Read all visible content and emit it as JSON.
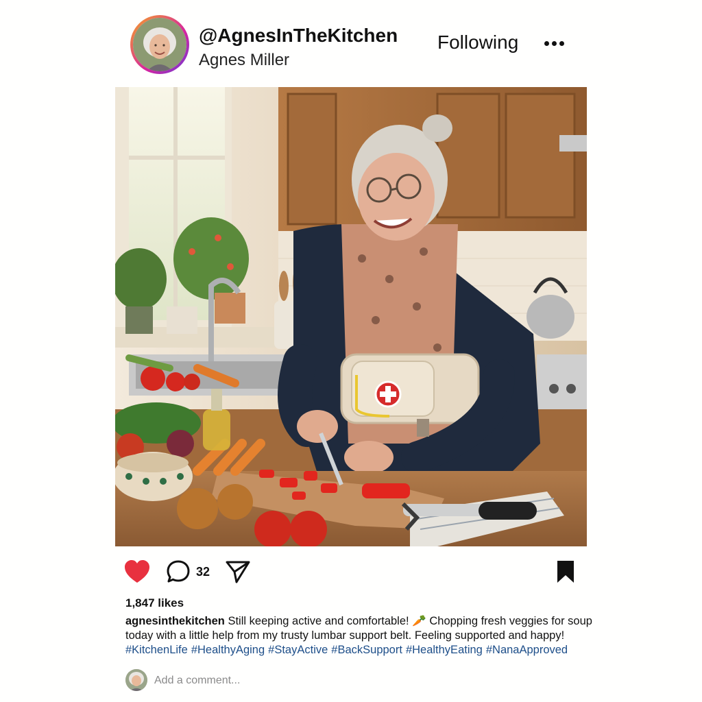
{
  "post": {
    "handle": "@AgnesInTheKitchen",
    "display_name": "Agnes Miller",
    "follow_label": "Following",
    "more_icon": "more-horizontal-icon"
  },
  "actions": {
    "like_icon": "heart-icon",
    "liked": true,
    "like_color": "#e8313f",
    "comment_icon": "comment-icon",
    "comment_count": "32",
    "share_icon": "send-icon",
    "save_icon": "bookmark-icon",
    "saved": true
  },
  "likes_text": "1,847 likes",
  "caption": {
    "username": "agnesinthekitchen",
    "text_before_emoji": "Still keeping active and comfortable!",
    "emoji": "🥕",
    "text_after_emoji": "Chopping fresh veggies for soup today with a little help from my trusty lumbar support belt. Feeling supported and happy!",
    "hashtags": [
      "#KitchenLife",
      "#HealthyAging",
      "#StayActive",
      "#BackSupport",
      "#HealthyEating",
      "#NanaApproved"
    ]
  },
  "comment_box": {
    "placeholder": "Add a comment..."
  },
  "colors": {
    "hashtag": "#1d4e89",
    "text": "#111111"
  }
}
